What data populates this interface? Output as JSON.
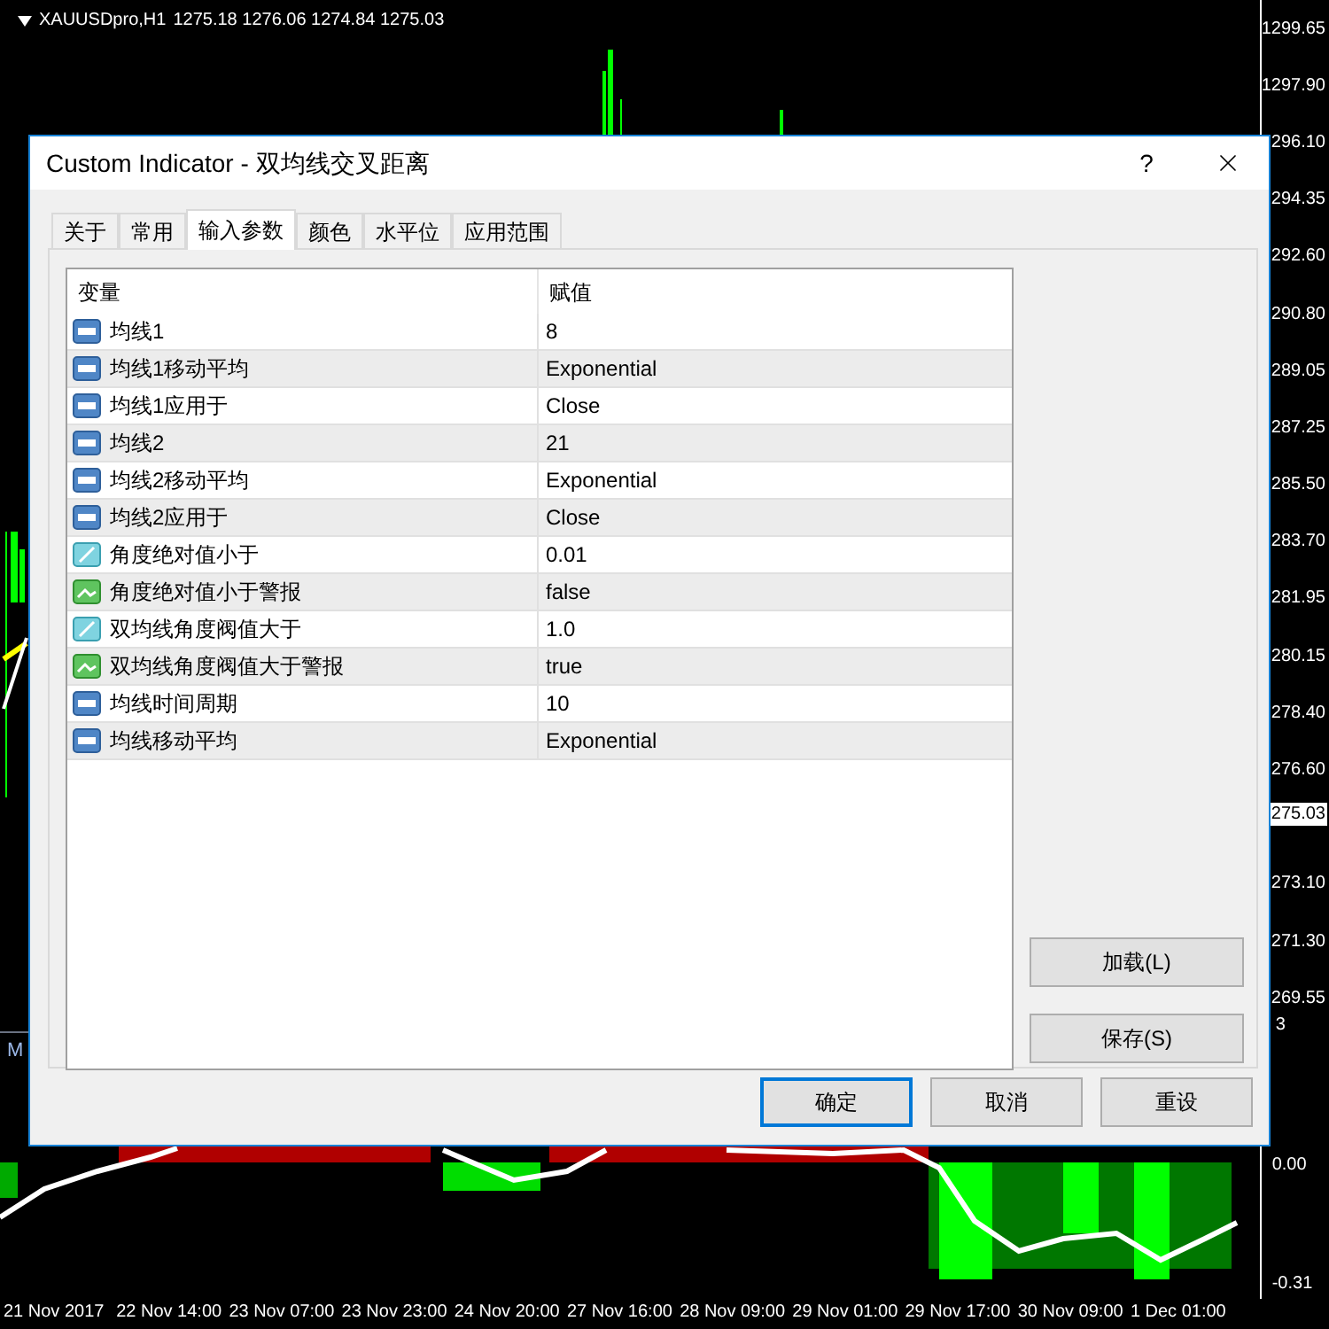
{
  "chart": {
    "symbol": "XAUUSDpro,H1",
    "ohlc": "1275.18 1276.06 1274.84 1275.03",
    "price_labels": [
      {
        "text": "1299.65",
        "kind": "price"
      },
      {
        "text": "1297.90",
        "kind": "price"
      },
      {
        "text": "296.10",
        "kind": "price"
      },
      {
        "text": "294.35",
        "kind": "price"
      },
      {
        "text": "292.60",
        "kind": "price"
      },
      {
        "text": "290.80",
        "kind": "price"
      },
      {
        "text": "289.05",
        "kind": "price"
      },
      {
        "text": "287.25",
        "kind": "price"
      },
      {
        "text": "285.50",
        "kind": "price"
      },
      {
        "text": "283.70",
        "kind": "price"
      },
      {
        "text": "281.95",
        "kind": "price"
      },
      {
        "text": "280.15",
        "kind": "price"
      },
      {
        "text": "278.40",
        "kind": "price"
      },
      {
        "text": "276.60",
        "kind": "price"
      },
      {
        "text": "275.03",
        "kind": "current"
      },
      {
        "text": "273.10",
        "kind": "price"
      },
      {
        "text": "271.30",
        "kind": "price"
      },
      {
        "text": "269.55",
        "kind": "price"
      },
      {
        "text": "3",
        "kind": "fragment"
      }
    ],
    "subwindow": {
      "label": "M",
      "scale_labels": [
        "0.00",
        "-0.31"
      ]
    },
    "time_labels": [
      "21 Nov 2017",
      "22 Nov 14:00",
      "23 Nov 07:00",
      "23 Nov 23:00",
      "24 Nov 20:00",
      "27 Nov 16:00",
      "28 Nov 09:00",
      "29 Nov 01:00",
      "29 Nov 17:00",
      "30 Nov 09:00",
      "1 Dec 01:00"
    ]
  },
  "dialog": {
    "title": "Custom Indicator - 双均线交叉距离",
    "help": "?",
    "tabs": [
      {
        "label": "关于",
        "selected": false
      },
      {
        "label": "常用",
        "selected": false
      },
      {
        "label": "输入参数",
        "selected": true
      },
      {
        "label": "颜色",
        "selected": false
      },
      {
        "label": "水平位",
        "selected": false
      },
      {
        "label": "应用范围",
        "selected": false
      }
    ],
    "table": {
      "columns": [
        "变量",
        "赋值"
      ],
      "rows": [
        {
          "name": "均线1",
          "value": "8",
          "kind": "int"
        },
        {
          "name": "均线1移动平均",
          "value": "Exponential",
          "kind": "int"
        },
        {
          "name": "均线1应用于",
          "value": "Close",
          "kind": "int"
        },
        {
          "name": "均线2",
          "value": "21",
          "kind": "int"
        },
        {
          "name": "均线2移动平均",
          "value": "Exponential",
          "kind": "int"
        },
        {
          "name": "均线2应用于",
          "value": "Close",
          "kind": "int"
        },
        {
          "name": "角度绝对值小于",
          "value": "0.01",
          "kind": "double"
        },
        {
          "name": "角度绝对值小于警报",
          "value": "false",
          "kind": "bool"
        },
        {
          "name": "双均线角度阀值大于",
          "value": "1.0",
          "kind": "double"
        },
        {
          "name": "双均线角度阀值大于警报",
          "value": "true",
          "kind": "bool"
        },
        {
          "name": "均线时间周期",
          "value": "10",
          "kind": "int"
        },
        {
          "name": "均线移动平均",
          "value": "Exponential",
          "kind": "int"
        }
      ]
    },
    "side_buttons": [
      "加载(L)",
      "保存(S)"
    ],
    "buttons": [
      {
        "label": "确定",
        "default": true
      },
      {
        "label": "取消",
        "default": false
      },
      {
        "label": "重设",
        "default": false
      }
    ]
  }
}
